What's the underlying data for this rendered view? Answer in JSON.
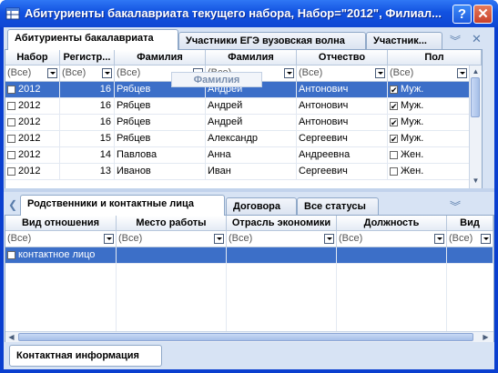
{
  "window": {
    "title": "Абитуриенты бакалавриата текущего набора, Набор=\"2012\", Филиал...",
    "help_label": "?",
    "close_label": "✕"
  },
  "top_tabs": [
    {
      "label": "Абитуриенты бакалавриата"
    },
    {
      "label": "Участники ЕГЭ вузовская волна"
    },
    {
      "label": "Участник..."
    }
  ],
  "main_grid": {
    "columns": [
      {
        "label": "Набор"
      },
      {
        "label": "Регистр..."
      },
      {
        "label": "Фамилия"
      },
      {
        "label": "Фамилия"
      },
      {
        "label": "Отчество"
      },
      {
        "label": "Пол"
      }
    ],
    "drag_hint": "Фамилия",
    "filter_placeholder": "(Все)",
    "rows": [
      {
        "checked": false,
        "nabor": "2012",
        "reg": "16",
        "surname": "Рябцев",
        "name": "Андрей",
        "patronymic": "Антонович",
        "gender_checked": true,
        "gender": "Муж."
      },
      {
        "checked": false,
        "nabor": "2012",
        "reg": "16",
        "surname": "Рябцев",
        "name": "Андрей",
        "patronymic": "Антонович",
        "gender_checked": true,
        "gender": "Муж."
      },
      {
        "checked": false,
        "nabor": "2012",
        "reg": "16",
        "surname": "Рябцев",
        "name": "Андрей",
        "patronymic": "Антонович",
        "gender_checked": true,
        "gender": "Муж."
      },
      {
        "checked": false,
        "nabor": "2012",
        "reg": "15",
        "surname": "Рябцев",
        "name": "Александр",
        "patronymic": "Сергеевич",
        "gender_checked": true,
        "gender": "Муж."
      },
      {
        "checked": false,
        "nabor": "2012",
        "reg": "14",
        "surname": "Павлова",
        "name": "Анна",
        "patronymic": "Андреевна",
        "gender_checked": false,
        "gender": "Жен."
      },
      {
        "checked": false,
        "nabor": "2012",
        "reg": "13",
        "surname": "Иванов",
        "name": "Иван",
        "patronymic": "Сергеевич",
        "gender_checked": false,
        "gender": "Жен."
      }
    ]
  },
  "bottom_tabs": [
    {
      "label": "Родственники и контактные лица"
    },
    {
      "label": "Договора"
    },
    {
      "label": "Все статусы"
    }
  ],
  "detail_grid": {
    "columns": [
      {
        "label": "Вид отношения"
      },
      {
        "label": "Место работы"
      },
      {
        "label": "Отрасль экономики"
      },
      {
        "label": "Должность"
      },
      {
        "label": "Вид"
      }
    ],
    "filter_placeholder": "(Все)",
    "rows": [
      {
        "checked": false,
        "relation": "контактное лицо"
      }
    ]
  },
  "footer_tab": {
    "label": "Контактная информация"
  }
}
